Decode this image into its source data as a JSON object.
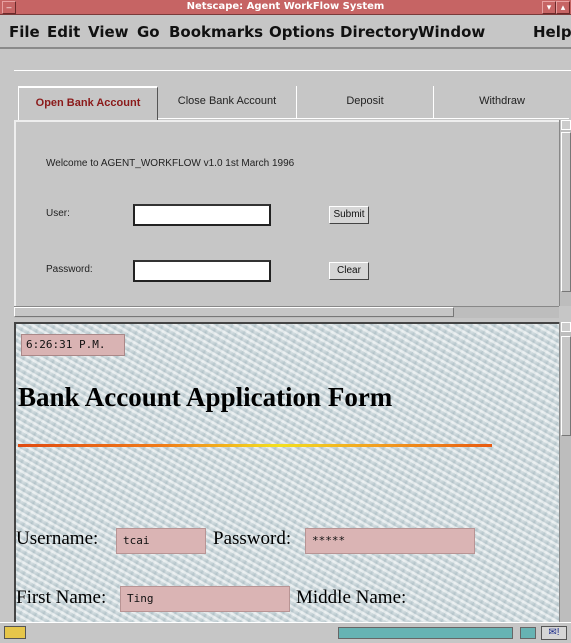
{
  "window": {
    "title": "Netscape: Agent WorkFlow System"
  },
  "menu": [
    "File",
    "Edit",
    "View",
    "Go",
    "Bookmarks",
    "Options",
    "Directory",
    "Window",
    "Help"
  ],
  "tabs": [
    {
      "label": "Open Bank Account",
      "active": true
    },
    {
      "label": "Close Bank Account",
      "active": false
    },
    {
      "label": "Deposit",
      "active": false
    },
    {
      "label": "Withdraw",
      "active": false
    }
  ],
  "login": {
    "welcome": "Welcome to AGENT_WORKFLOW v1.0 1st March 1996",
    "user_label": "User:",
    "user_value": "",
    "password_label": "Password:",
    "password_value": "",
    "submit_label": "Submit",
    "clear_label": "Clear"
  },
  "form": {
    "clock": "6:26:31 P.M.",
    "heading": "Bank Account Application Form",
    "username_label": "Username:",
    "username_value": "tcai",
    "password_label": "Password:",
    "password_value": "*****",
    "firstname_label": "First Name:",
    "firstname_value": "Ting",
    "middlename_label": "Middle Name:"
  },
  "colors": {
    "titlebar": "#c66464",
    "active_tab_text": "#8b1a1a",
    "field_fill": "#dab4b4",
    "progress_fill": "#66b3b3"
  }
}
